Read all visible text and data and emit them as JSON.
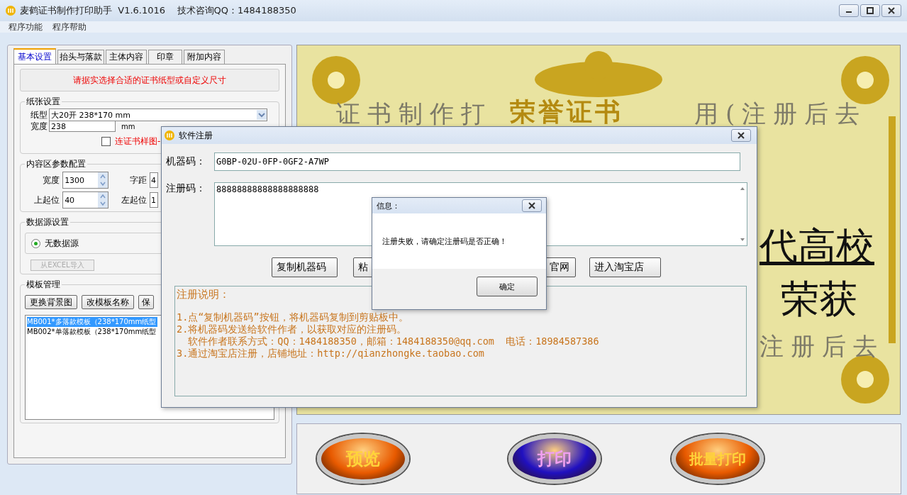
{
  "window": {
    "title": "麦鹤证书制作打印助手  V1.6.1016    技术咨询QQ：1484188350"
  },
  "menu": [
    "程序功能",
    "程序帮助"
  ],
  "tabs": [
    {
      "label": "基本设置",
      "selected": true
    },
    {
      "label": "抬头与落款",
      "selected": false
    },
    {
      "label": "主体内容",
      "selected": false
    },
    {
      "label": "印章",
      "selected": false
    },
    {
      "label": "附加内容",
      "selected": false
    }
  ],
  "notice": "请据实选择合适的证书纸型或自定义尺寸",
  "paper": {
    "title": "纸张设置",
    "type_label": "纸型",
    "type_value": "大20开 238*170 mm",
    "width_label": "宽度",
    "width_value": "238",
    "unit": "mm",
    "sample_checkbox": {
      "label": "连证书样图-",
      "checked": false
    }
  },
  "content_area": {
    "title": "内容区参数配置",
    "fields": [
      {
        "label": "宽度",
        "value": "1300",
        "kind": "spin"
      },
      {
        "label": "字距",
        "value": "4",
        "kind": "text"
      },
      {
        "label": "上起位",
        "value": "40",
        "kind": "spin"
      },
      {
        "label": "左起位",
        "value": "1",
        "kind": "text"
      }
    ]
  },
  "data_source": {
    "title": "数据源设置",
    "radio": {
      "label": "无数据源",
      "selected": true
    },
    "buttons": [
      {
        "label": "从EXCEL导入",
        "disabled": true
      }
    ]
  },
  "templates": {
    "title": "模板管理",
    "buttons": [
      "更换背景图",
      "改模板名称",
      "保"
    ],
    "items": [
      {
        "label": "MB001*多落款模板（238*170mm纸型",
        "selected": true
      },
      {
        "label": "MB002*单落款模板（238*170mm纸型",
        "selected": false
      }
    ]
  },
  "certificate": {
    "texts": [
      {
        "text": "证书制作打",
        "kind": "watermark"
      },
      {
        "text": "荣誉证书",
        "kind": "title"
      },
      {
        "text": "用(注册后去",
        "kind": "watermark"
      },
      {
        "text": "代高校",
        "kind": "body"
      },
      {
        "text": "荣获",
        "kind": "body"
      },
      {
        "text": "注册后去",
        "kind": "watermark"
      }
    ]
  },
  "print_buttons": [
    {
      "label": "预览",
      "color": "#e85a00"
    },
    {
      "label": "打印",
      "color": "#2010c0"
    },
    {
      "label": "批量打印",
      "color": "#e85a00"
    }
  ],
  "register_dialog": {
    "title": "软件注册",
    "machine_label": "机器码：",
    "machine_value": "G0BP-02U-0FP-0GF2-A7WP",
    "code_label": "注册码：",
    "code_value": "88888888888888888888",
    "buttons": [
      "复制机器码",
      "粘",
      "官网",
      "进入淘宝店"
    ],
    "notes_title": "注册说明：",
    "notes": [
      "1.点“复制机器码”按钮，将机器码复制到剪贴板中。",
      "2.将机器码发送给软件作者，以获取对应的注册码。",
      "  软件作者联系方式：QQ：1484188350，邮箱：1484188350@qq.com  电话：18984587386",
      "3.通过淘宝店注册，店铺地址：http://qianzhongke.taobao.com"
    ]
  },
  "message_box": {
    "title": "信息：",
    "message": "注册失败，请确定注册码是否正确！",
    "button": "确定"
  }
}
